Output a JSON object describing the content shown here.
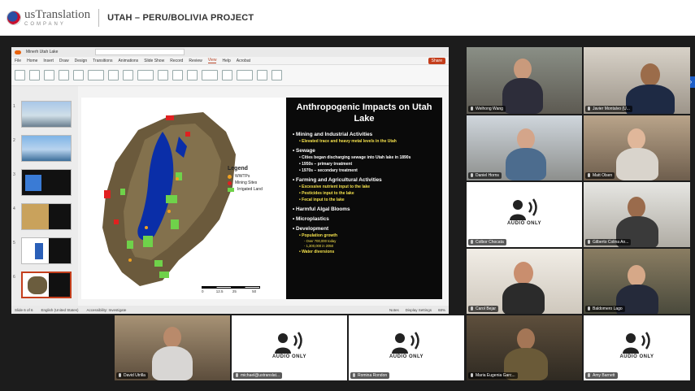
{
  "header": {
    "logo_main": "usTranslation",
    "logo_sub": "COMPANY",
    "title": "UTAH – PERU/BOLIVIA PROJECT"
  },
  "powerpoint": {
    "window_title": "Minerh Utah Lake",
    "menu": [
      "File",
      "Home",
      "Insert",
      "Draw",
      "Design",
      "Transitions",
      "Animations",
      "Slide Show",
      "Record",
      "Review",
      "View",
      "Help",
      "Acrobat"
    ],
    "active_menu": "View",
    "present_label": "Share",
    "status_left": "Slide 6 of 6",
    "status_lang": "English (United States)",
    "status_access": "Accessibility: Investigate",
    "status_notes": "Notes",
    "status_display": "Display Settings",
    "zoom": "68%"
  },
  "slide": {
    "title": "Anthropogenic Impacts on Utah Lake",
    "bullets": [
      {
        "level": 1,
        "text": "Mining and Industrial Activities"
      },
      {
        "level": 2,
        "text": "Elevated trace and heavy metal levels in the Utah"
      },
      {
        "level": 1,
        "text": "Sewage"
      },
      {
        "level": 2,
        "text": "Cities began discharging sewage into Utah lake in 1890s",
        "white": true
      },
      {
        "level": 2,
        "text": "1950s – primary treatment",
        "white": true
      },
      {
        "level": 2,
        "text": "1970s – secondary treatment",
        "white": true
      },
      {
        "level": 1,
        "text": "Farming and Agricultural Activities"
      },
      {
        "level": 2,
        "text": "Excessive nutrient input to the lake"
      },
      {
        "level": 2,
        "text": "Pesticides input to the lake"
      },
      {
        "level": 2,
        "text": "Fecal input to the lake"
      },
      {
        "level": 1,
        "text": "Harmful Algal Blooms"
      },
      {
        "level": 1,
        "text": "Microplastics"
      },
      {
        "level": 1,
        "text": "Development"
      },
      {
        "level": 2,
        "text": "Population growth"
      },
      {
        "level": 3,
        "text": "Over 700,000 today"
      },
      {
        "level": 3,
        "text": "1,300,000 in 2050"
      },
      {
        "level": 2,
        "text": "Water diversions"
      }
    ],
    "legend_title": "Legend",
    "legend": [
      {
        "label": "WWTPs",
        "color": "#f0a020"
      },
      {
        "label": "Mining Sites",
        "color": "#e02020"
      },
      {
        "label": "Irrigated Land",
        "color": "#6fd24a"
      }
    ],
    "scale_labels": [
      "0",
      "12.5",
      "25",
      "50"
    ]
  },
  "participants": [
    {
      "name": "Weihong Wang",
      "audio_only": false
    },
    {
      "name": "Javier Montalvo (U...",
      "audio_only": false
    },
    {
      "name": "Daniel Horns",
      "audio_only": false
    },
    {
      "name": "Matt Olsen",
      "audio_only": false
    },
    {
      "name": "Colbor Chocata",
      "audio_only": true
    },
    {
      "name": "Gilberto Colina An...",
      "audio_only": false
    },
    {
      "name": "Carol Bejar",
      "audio_only": false
    },
    {
      "name": "Baldomero Lago",
      "audio_only": false
    },
    {
      "name": "David Utrilla",
      "audio_only": false
    },
    {
      "name": "michael@ustranslat...",
      "audio_only": true
    },
    {
      "name": "Romina Rondon",
      "audio_only": true
    },
    {
      "name": "Maria Eugenia Garc...",
      "audio_only": false
    },
    {
      "name": "Amy Barnett",
      "audio_only": true
    }
  ],
  "audio_only_label": "AUDIO ONLY"
}
